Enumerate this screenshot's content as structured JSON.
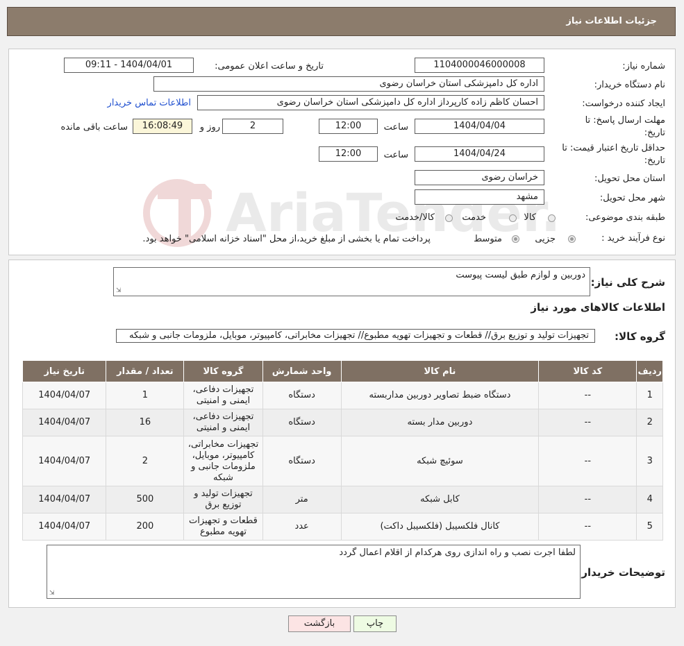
{
  "header": {
    "title": "جزئیات اطلاعات نیاز"
  },
  "form": {
    "need_number_label": "شماره نیاز:",
    "need_number": "1104000046000008",
    "announce_label": "تاریخ و ساعت اعلان عمومی:",
    "announce_value": "1404/04/01 - 09:11",
    "buyer_label": "نام دستگاه خریدار:",
    "buyer_value": "اداره کل دامپزشکی استان خراسان رضوی",
    "creator_label": "ایجاد کننده درخواست:",
    "creator_value": "احسان کاظم زاده کارپرداز اداره کل دامپزشکی استان خراسان رضوی",
    "contact_link": "اطلاعات تماس خریدار",
    "deadline_label_1": "مهلت ارسال پاسخ: تا",
    "deadline_label_2": "تاریخ:",
    "deadline_date": "1404/04/04",
    "hour_label": "ساعت",
    "deadline_time": "12:00",
    "days_value": "2",
    "days_label": "روز و",
    "remaining_time": "16:08:49",
    "remaining_label": "ساعت باقی مانده",
    "validity_label_1": "حداقل تاریخ اعتبار قیمت: تا",
    "validity_label_2": "تاریخ:",
    "validity_date": "1404/04/24",
    "validity_hour_label": "ساعت",
    "validity_time": "12:00",
    "province_label": "استان محل تحویل:",
    "province_value": "خراسان رضوی",
    "city_label": "شهر محل تحویل:",
    "city_value": "مشهد",
    "category_label": "طبقه بندی موضوعی:",
    "category_options": [
      "کالا",
      "خدمت",
      "کالا/خدمت"
    ],
    "purchase_label": "نوع فرآیند خرید :",
    "purchase_options": [
      "جزیی",
      "متوسط"
    ],
    "purchase_note": "پرداخت تمام یا بخشی از مبلغ خرید،از محل \"اسناد خزانه اسلامی\" خواهد بود."
  },
  "summary": {
    "label": "شرح کلی نیاز:",
    "value": "دوربین و لوازم طبق لیست پیوست",
    "items_title": "اطلاعات کالاهای مورد نیاز",
    "group_label": "گروه کالا:",
    "group_value": "تجهیزات تولید و توزیع برق//  قطعات و تجهیزات تهویه مطبوع// تجهیزات مخابراتی، کامپیوتر، موبایل، ملزومات جانبی و شبکه"
  },
  "table": {
    "headers": [
      "ردیف",
      "کد کالا",
      "نام کالا",
      "واحد شمارش",
      "گروه کالا",
      "تعداد / مقدار",
      "تاریخ نیاز"
    ],
    "rows": [
      {
        "idx": "1",
        "code": "--",
        "name": "دستگاه ضبط تصاویر دوربین مداربسته",
        "unit": "دستگاه",
        "group": "تجهیزات دفاعی، ایمنی و امنیتی",
        "qty": "1",
        "date": "1404/04/07"
      },
      {
        "idx": "2",
        "code": "--",
        "name": "دوربین مدار بسته",
        "unit": "دستگاه",
        "group": "تجهیزات دفاعی، ایمنی و امنیتی",
        "qty": "16",
        "date": "1404/04/07"
      },
      {
        "idx": "3",
        "code": "--",
        "name": "سوئیچ شبکه",
        "unit": "دستگاه",
        "group": "تجهیزات مخابراتی، کامپیوتر، موبایل، ملزومات جانبی و شبکه",
        "qty": "2",
        "date": "1404/04/07"
      },
      {
        "idx": "4",
        "code": "--",
        "name": "کابل شبکه",
        "unit": "متر",
        "group": "تجهیزات تولید و توزیع برق",
        "qty": "500",
        "date": "1404/04/07"
      },
      {
        "idx": "5",
        "code": "--",
        "name": "کانال فلکسیبل (فلکسیبل داکت)",
        "unit": "عدد",
        "group": "قطعات و تجهیزات تهویه مطبوع",
        "qty": "200",
        "date": "1404/04/07"
      }
    ]
  },
  "notes": {
    "label": "توضیحات خریدار:",
    "value": "لطفا اجرت نصب و راه اندازی روی هرکدام از اقلام اعمال گردد"
  },
  "buttons": {
    "print": "چاپ",
    "back": "بازگشت"
  },
  "watermark": {
    "text": "AriaTender.net"
  },
  "colors": {
    "header": "#8c7c6c",
    "table_header": "#7f7063",
    "link": "#1f4fcf",
    "print_btn": "#eefbe3",
    "back_btn": "#fce4e4"
  }
}
